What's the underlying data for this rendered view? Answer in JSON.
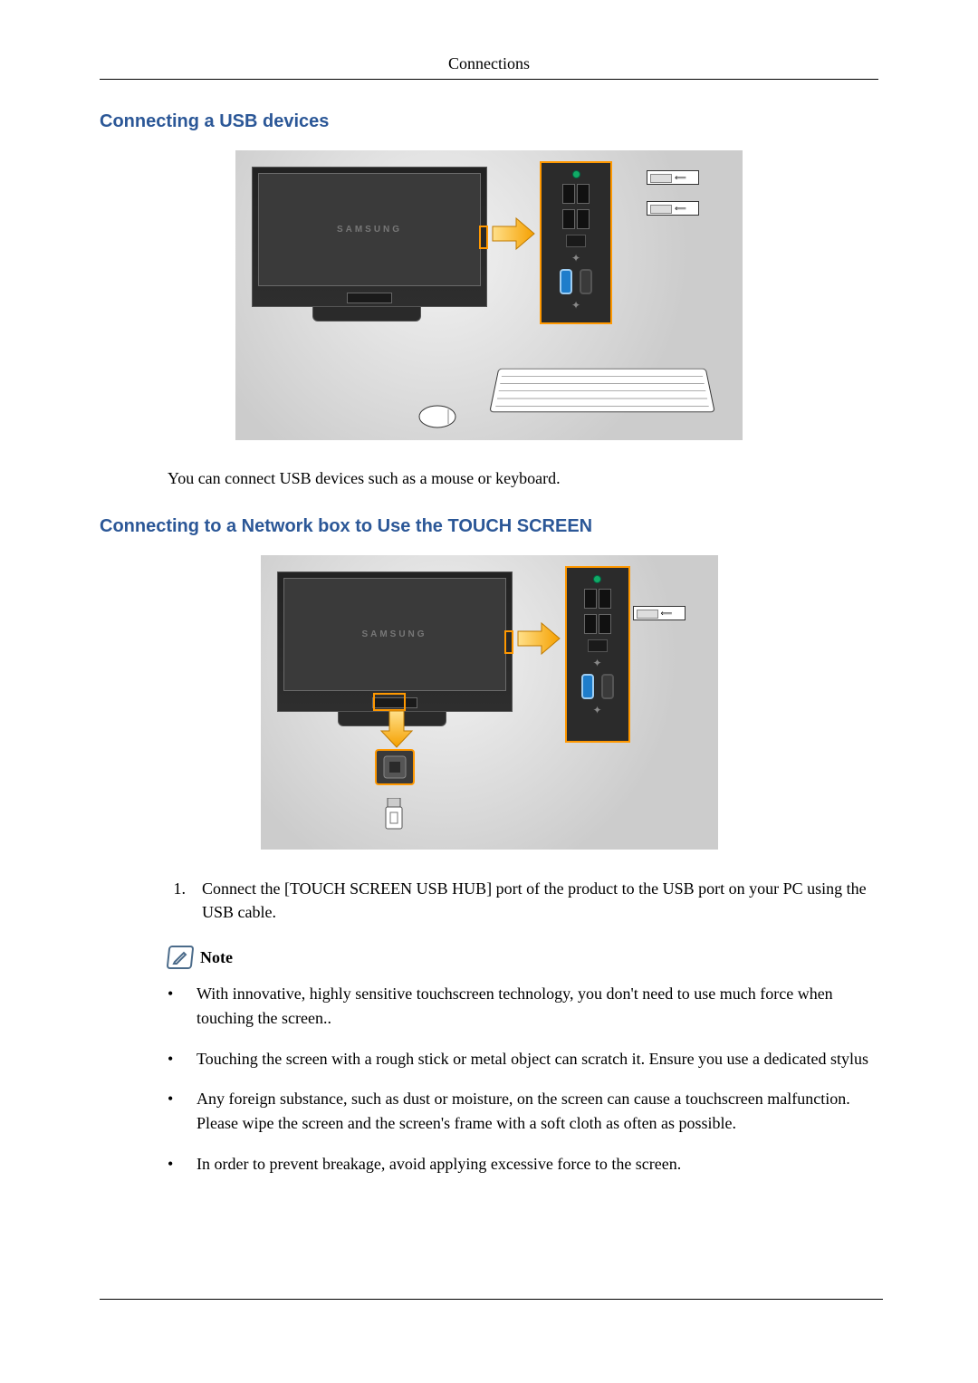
{
  "header": {
    "title": "Connections"
  },
  "section1": {
    "title": "Connecting a USB devices",
    "monitor_brand_1": "SAMSUNG",
    "caption": "You can connect USB devices such as a mouse or keyboard."
  },
  "section2": {
    "title": "Connecting to a Network box to Use the TOUCH SCREEN",
    "monitor_brand_2": "SAMSUNG",
    "steps": [
      {
        "num": "1.",
        "text": "Connect the [TOUCH SCREEN USB HUB] port of the product to the USB port on your PC using the USB cable."
      }
    ],
    "note_label": "Note",
    "bullets": [
      "With innovative, highly sensitive touchscreen technology, you don't need to use much force when touching the screen..",
      "Touching the screen with a rough stick or metal object can scratch it. Ensure you use a dedicated stylus",
      "Any foreign substance, such as dust or moisture, on the screen can cause a touchscreen malfunction. Please wipe the screen and the screen's frame with a soft cloth as often as possible.",
      "In order to prevent breakage, avoid applying excessive force to the screen."
    ]
  }
}
